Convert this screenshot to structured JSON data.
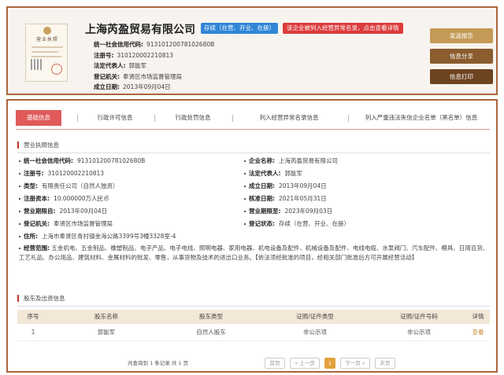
{
  "header": {
    "license_image": {
      "title": "营业执照",
      "icon": "business-license-image"
    },
    "company_name": "上海芮盈贸易有限公司",
    "status_badge": "存续（在营、开业、在册）",
    "abnormal_badge": "该企业被列入经营异常名录，点击查看详情",
    "info": [
      {
        "label": "统一社会信用代码:",
        "value": "91310120078102680B"
      },
      {
        "label": "注册号:",
        "value": "310120002210813"
      },
      {
        "label": "法定代表人:",
        "value": "郭能军"
      },
      {
        "label": "登记机关:",
        "value": "奉贤区市场监督管理局"
      },
      {
        "label": "成立日期:",
        "value": "2013年09月04日"
      }
    ],
    "buttons": {
      "report": "发送报告",
      "share": "信息分享",
      "print": "信息打印"
    }
  },
  "tabs": [
    "基础信息",
    "行政许可信息",
    "行政处罚信息",
    "列入经营异常名录信息",
    "列入严重违法失信企业名单（黑名单）信息"
  ],
  "business_license": {
    "section_title": "营业执照信息",
    "left": [
      {
        "label": "统一社会信用代码:",
        "value": "91310120078102680B"
      },
      {
        "label": "注册号:",
        "value": "310120002210813"
      },
      {
        "label": "类型:",
        "value": "有限责任公司（自然人独资）"
      },
      {
        "label": "注册资本:",
        "value": "10.000000万人民币"
      },
      {
        "label": "营业期限自:",
        "value": "2013年09月04日"
      },
      {
        "label": "登记机关:",
        "value": "奉贤区市场监督管理局"
      }
    ],
    "right": [
      {
        "label": "企业名称:",
        "value": "上海芮盈贸易有限公司"
      },
      {
        "label": "法定代表人:",
        "value": "郭能军"
      },
      {
        "label": "成立日期:",
        "value": "2013年09月04日"
      },
      {
        "label": "核准日期:",
        "value": "2021年05月31日"
      },
      {
        "label": "营业期限至:",
        "value": "2023年09月03日"
      },
      {
        "label": "登记状态:",
        "value": "存续（在营、开业、在册）"
      }
    ],
    "address": {
      "label": "住所:",
      "value": "上海市奉贤区青村镇金海公路3399号3幢3328室-4"
    },
    "scope": {
      "label": "经营范围:",
      "value": "五金机电、五金制品、橡塑制品、电子产品、电子电线、照明电器、家用电器、机电设备及配件、机械设备及配件、电线电缆、水泵阀门、汽车配件、模具、日用百货、工艺礼品、办公用品、建筑材料、金属材料的批发、零售，从事货物及技术的进出口业务。【依法须经批准的项目，经相关部门批准后方可开展经营活动】"
    }
  },
  "shareholders": {
    "section_title": "股东及出资信息",
    "columns": [
      "序号",
      "股东名称",
      "股东类型",
      "证照/证件类型",
      "证照/证件号码",
      "详情"
    ],
    "rows": [
      [
        "1",
        "郭能军",
        "自然人股东",
        "非公示项",
        "非公示项",
        "查看"
      ]
    ],
    "pager": {
      "summary": "共查询到 1 条记录 共 1 页",
      "first": "首页",
      "prev": "« 上一页",
      "current": "1",
      "next": "下一页 »",
      "last": "末页"
    }
  }
}
